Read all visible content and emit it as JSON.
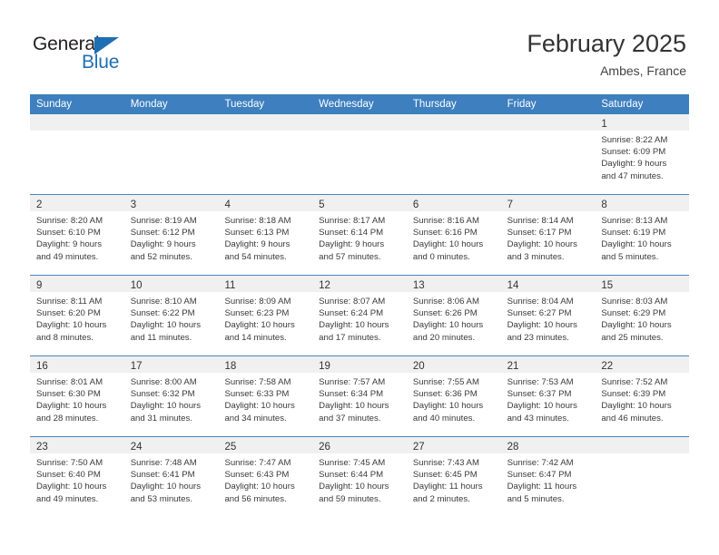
{
  "brand": {
    "name_part1": "General",
    "name_part2": "Blue",
    "mark": "triangle-flag-icon",
    "colors": {
      "dark": "#231f20",
      "blue": "#1f6fb4"
    }
  },
  "header": {
    "title": "February 2025",
    "subtitle": "Ambes, France"
  },
  "theme": {
    "header_row_bg": "#3d7fbf",
    "header_row_text": "#ffffff",
    "daynum_strip_bg": "#f0f0f0",
    "row_divider": "#4a86c4",
    "body_text": "#3a3a3a"
  },
  "weekdays": [
    "Sunday",
    "Monday",
    "Tuesday",
    "Wednesday",
    "Thursday",
    "Friday",
    "Saturday"
  ],
  "weeks": [
    [
      {
        "day": "",
        "lines": []
      },
      {
        "day": "",
        "lines": []
      },
      {
        "day": "",
        "lines": []
      },
      {
        "day": "",
        "lines": []
      },
      {
        "day": "",
        "lines": []
      },
      {
        "day": "",
        "lines": []
      },
      {
        "day": "1",
        "lines": [
          "Sunrise: 8:22 AM",
          "Sunset: 6:09 PM",
          "Daylight: 9 hours",
          "and 47 minutes."
        ]
      }
    ],
    [
      {
        "day": "2",
        "lines": [
          "Sunrise: 8:20 AM",
          "Sunset: 6:10 PM",
          "Daylight: 9 hours",
          "and 49 minutes."
        ]
      },
      {
        "day": "3",
        "lines": [
          "Sunrise: 8:19 AM",
          "Sunset: 6:12 PM",
          "Daylight: 9 hours",
          "and 52 minutes."
        ]
      },
      {
        "day": "4",
        "lines": [
          "Sunrise: 8:18 AM",
          "Sunset: 6:13 PM",
          "Daylight: 9 hours",
          "and 54 minutes."
        ]
      },
      {
        "day": "5",
        "lines": [
          "Sunrise: 8:17 AM",
          "Sunset: 6:14 PM",
          "Daylight: 9 hours",
          "and 57 minutes."
        ]
      },
      {
        "day": "6",
        "lines": [
          "Sunrise: 8:16 AM",
          "Sunset: 6:16 PM",
          "Daylight: 10 hours",
          "and 0 minutes."
        ]
      },
      {
        "day": "7",
        "lines": [
          "Sunrise: 8:14 AM",
          "Sunset: 6:17 PM",
          "Daylight: 10 hours",
          "and 3 minutes."
        ]
      },
      {
        "day": "8",
        "lines": [
          "Sunrise: 8:13 AM",
          "Sunset: 6:19 PM",
          "Daylight: 10 hours",
          "and 5 minutes."
        ]
      }
    ],
    [
      {
        "day": "9",
        "lines": [
          "Sunrise: 8:11 AM",
          "Sunset: 6:20 PM",
          "Daylight: 10 hours",
          "and 8 minutes."
        ]
      },
      {
        "day": "10",
        "lines": [
          "Sunrise: 8:10 AM",
          "Sunset: 6:22 PM",
          "Daylight: 10 hours",
          "and 11 minutes."
        ]
      },
      {
        "day": "11",
        "lines": [
          "Sunrise: 8:09 AM",
          "Sunset: 6:23 PM",
          "Daylight: 10 hours",
          "and 14 minutes."
        ]
      },
      {
        "day": "12",
        "lines": [
          "Sunrise: 8:07 AM",
          "Sunset: 6:24 PM",
          "Daylight: 10 hours",
          "and 17 minutes."
        ]
      },
      {
        "day": "13",
        "lines": [
          "Sunrise: 8:06 AM",
          "Sunset: 6:26 PM",
          "Daylight: 10 hours",
          "and 20 minutes."
        ]
      },
      {
        "day": "14",
        "lines": [
          "Sunrise: 8:04 AM",
          "Sunset: 6:27 PM",
          "Daylight: 10 hours",
          "and 23 minutes."
        ]
      },
      {
        "day": "15",
        "lines": [
          "Sunrise: 8:03 AM",
          "Sunset: 6:29 PM",
          "Daylight: 10 hours",
          "and 25 minutes."
        ]
      }
    ],
    [
      {
        "day": "16",
        "lines": [
          "Sunrise: 8:01 AM",
          "Sunset: 6:30 PM",
          "Daylight: 10 hours",
          "and 28 minutes."
        ]
      },
      {
        "day": "17",
        "lines": [
          "Sunrise: 8:00 AM",
          "Sunset: 6:32 PM",
          "Daylight: 10 hours",
          "and 31 minutes."
        ]
      },
      {
        "day": "18",
        "lines": [
          "Sunrise: 7:58 AM",
          "Sunset: 6:33 PM",
          "Daylight: 10 hours",
          "and 34 minutes."
        ]
      },
      {
        "day": "19",
        "lines": [
          "Sunrise: 7:57 AM",
          "Sunset: 6:34 PM",
          "Daylight: 10 hours",
          "and 37 minutes."
        ]
      },
      {
        "day": "20",
        "lines": [
          "Sunrise: 7:55 AM",
          "Sunset: 6:36 PM",
          "Daylight: 10 hours",
          "and 40 minutes."
        ]
      },
      {
        "day": "21",
        "lines": [
          "Sunrise: 7:53 AM",
          "Sunset: 6:37 PM",
          "Daylight: 10 hours",
          "and 43 minutes."
        ]
      },
      {
        "day": "22",
        "lines": [
          "Sunrise: 7:52 AM",
          "Sunset: 6:39 PM",
          "Daylight: 10 hours",
          "and 46 minutes."
        ]
      }
    ],
    [
      {
        "day": "23",
        "lines": [
          "Sunrise: 7:50 AM",
          "Sunset: 6:40 PM",
          "Daylight: 10 hours",
          "and 49 minutes."
        ]
      },
      {
        "day": "24",
        "lines": [
          "Sunrise: 7:48 AM",
          "Sunset: 6:41 PM",
          "Daylight: 10 hours",
          "and 53 minutes."
        ]
      },
      {
        "day": "25",
        "lines": [
          "Sunrise: 7:47 AM",
          "Sunset: 6:43 PM",
          "Daylight: 10 hours",
          "and 56 minutes."
        ]
      },
      {
        "day": "26",
        "lines": [
          "Sunrise: 7:45 AM",
          "Sunset: 6:44 PM",
          "Daylight: 10 hours",
          "and 59 minutes."
        ]
      },
      {
        "day": "27",
        "lines": [
          "Sunrise: 7:43 AM",
          "Sunset: 6:45 PM",
          "Daylight: 11 hours",
          "and 2 minutes."
        ]
      },
      {
        "day": "28",
        "lines": [
          "Sunrise: 7:42 AM",
          "Sunset: 6:47 PM",
          "Daylight: 11 hours",
          "and 5 minutes."
        ]
      },
      {
        "day": "",
        "lines": []
      }
    ]
  ]
}
